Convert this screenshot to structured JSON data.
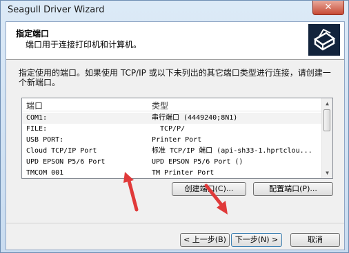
{
  "window": {
    "title": "Seagull Driver Wizard",
    "close_glyph": "✕"
  },
  "header": {
    "title": "指定端口",
    "subtitle": "端口用于连接打印机和计算机。",
    "logo_icon": "printer-logo-icon"
  },
  "description": "指定使用的端口。如果使用 TCP/IP 或以下未列出的其它端口类型进行连接，请创建一个新端口。",
  "port_list": {
    "columns": [
      "端口",
      "类型"
    ],
    "rows": [
      {
        "port": "COM1:",
        "type": "串行端口 (4449240;8N1)"
      },
      {
        "port": "FILE:",
        "type": "TCP/P/"
      },
      {
        "port": "USB PORT:",
        "type": "Printer Port"
      },
      {
        "port": "Cloud TCP/IP Port",
        "type": "标准 TCP/IP 端口 (api-sh33-1.hprtclou..."
      },
      {
        "port": "UPD EPSON P5/6 Port",
        "type": "UPD EPSON P5/6 Port ()"
      },
      {
        "port": "TMCOM 001",
        "type": "TM Printer Port"
      }
    ]
  },
  "buttons": {
    "create_port": "创建端口(C)...",
    "configure_port": "配置端口(P)...",
    "back": "< 上一步(B)",
    "next": "下一步(N) >",
    "cancel": "取消"
  },
  "colors": {
    "annotation_arrow": "#e03a3a",
    "logo_background": "#12233c"
  }
}
